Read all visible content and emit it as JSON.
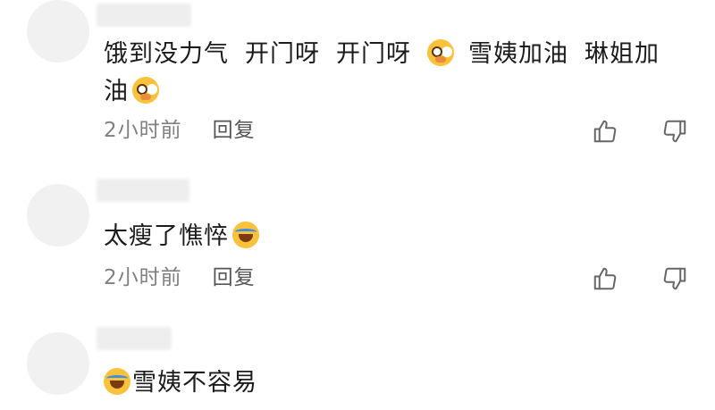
{
  "comments": [
    {
      "content_segments": [
        "饿到没力气",
        "开门呀",
        "开门呀"
      ],
      "emoji_1": "pleading-face-emoji",
      "content_tail_1": "雪姨加油",
      "content_tail_2": "琳姐加",
      "content_line2": "油",
      "emoji_2": "pleading-face-emoji",
      "time": "2小时前",
      "reply_label": "回复"
    },
    {
      "content": "太瘦了憔悴",
      "emoji": "laughing-crying-face-emoji",
      "time": "2小时前",
      "reply_label": "回复"
    },
    {
      "emoji": "laughing-crying-face-emoji",
      "content": "雪姨不容易"
    }
  ],
  "icons": {
    "like": "thumbs-up-icon",
    "dislike": "thumbs-down-icon"
  },
  "colors": {
    "text_primary": "#1c1c1c",
    "text_meta": "#808080",
    "avatar_placeholder": "#f1f1f1",
    "emoji_yellow": "#f9c23c"
  }
}
